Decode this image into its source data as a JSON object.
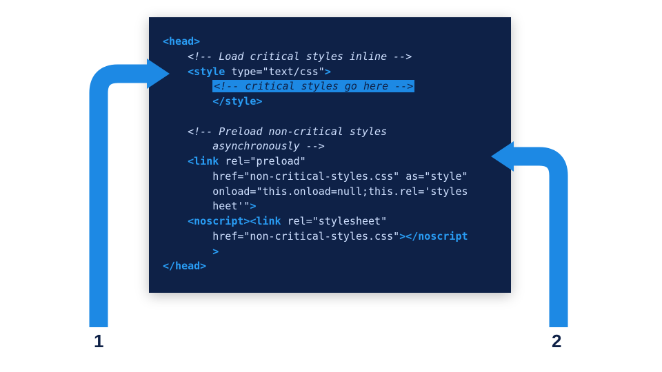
{
  "labels": {
    "num1": "1",
    "num2": "2"
  },
  "code": {
    "l1": {
      "open": "<head>"
    },
    "l2": {
      "comment": "<!-- Load critical styles inline -->"
    },
    "l3": {
      "open": "<style",
      "attrs": " type=\"text/css\"",
      "close": ">"
    },
    "l4": {
      "highlight": "<!-- critical styles go here -->"
    },
    "l5": {
      "close": "</style>"
    },
    "l7a": {
      "comment": "<!-- Preload non-critical styles"
    },
    "l7b": {
      "comment": "asynchronously -->"
    },
    "l8": {
      "open": "<link",
      "attrs": " rel=\"preload\""
    },
    "l9": {
      "attrs": "href=\"non-critical-styles.css\" as=\"style\""
    },
    "l10": {
      "attrs": "onload=\"this.onload=null;this.rel='styles"
    },
    "l10b": {
      "attrs": "heet'\"",
      "close": ">"
    },
    "l11": {
      "open1": "<noscript>",
      "open2": "<link",
      "attrs": " rel=\"stylesheet\""
    },
    "l12": {
      "attrs": "href=\"non-critical-styles.css\"",
      "close1": ">",
      "close2": "</noscript",
      "close3": ">"
    },
    "l13": {
      "close": "</head>"
    }
  },
  "colors": {
    "boxBg": "#0e2147",
    "accent": "#1d89e4",
    "tag": "#299df5"
  }
}
